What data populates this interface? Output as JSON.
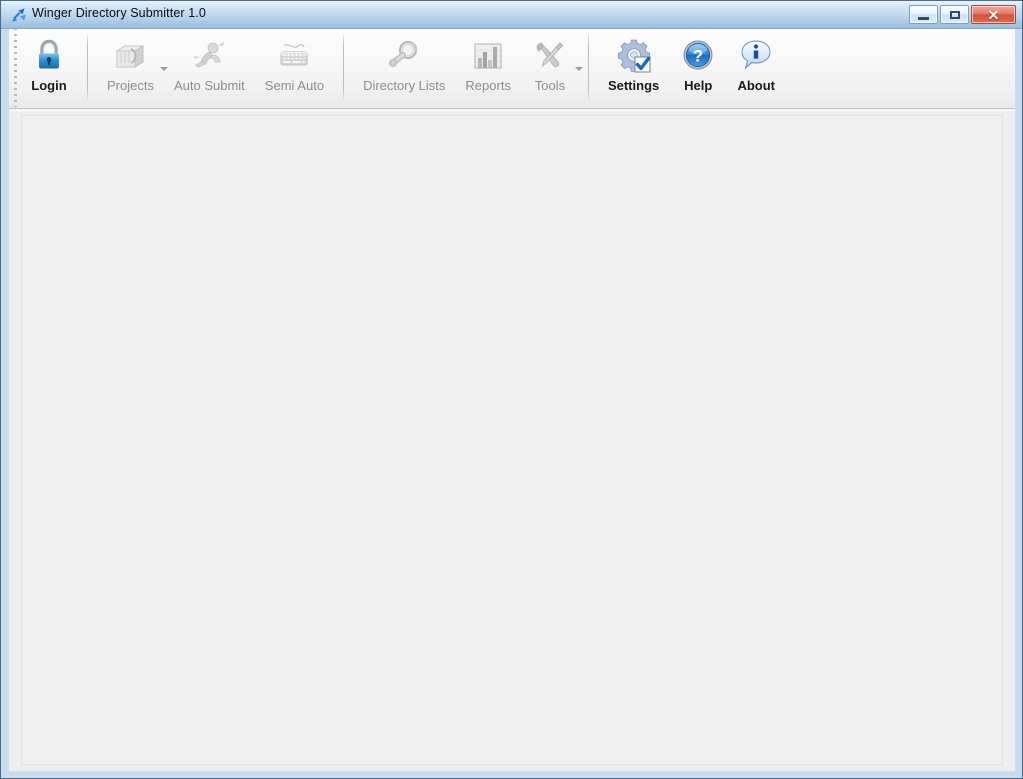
{
  "window": {
    "title": "Winger Directory Submitter 1.0",
    "app_icon": "blue-dart-icon",
    "controls": {
      "minimize_label": "Minimize",
      "maximize_label": "Maximize",
      "close_label": "Close"
    },
    "accent_color": "#a8c8e6",
    "frame_color": "#c9dcf0",
    "client_bg": "#eeeeee"
  },
  "toolbar": {
    "groups": [
      {
        "items": [
          {
            "label": "Login",
            "icon": "padlock-icon",
            "enabled": true,
            "has_dropdown": false
          }
        ]
      },
      {
        "items": [
          {
            "label": "Projects",
            "icon": "card-file-icon",
            "enabled": false,
            "has_dropdown": true
          },
          {
            "label": "Auto Submit",
            "icon": "running-person-icon",
            "enabled": false,
            "has_dropdown": false
          },
          {
            "label": "Semi Auto",
            "icon": "keyboard-icon",
            "enabled": false,
            "has_dropdown": false
          }
        ]
      },
      {
        "items": [
          {
            "label": "Directory Lists",
            "icon": "magnifier-icon",
            "enabled": false,
            "has_dropdown": false
          },
          {
            "label": "Reports",
            "icon": "bar-chart-icon",
            "enabled": false,
            "has_dropdown": false
          },
          {
            "label": "Tools",
            "icon": "wrench-screwdriver-icon",
            "enabled": false,
            "has_dropdown": true
          }
        ]
      },
      {
        "items": [
          {
            "label": "Settings",
            "icon": "gear-check-icon",
            "enabled": true,
            "has_dropdown": false
          },
          {
            "label": "Help",
            "icon": "question-circle-icon",
            "enabled": true,
            "has_dropdown": false
          },
          {
            "label": "About",
            "icon": "info-bubble-icon",
            "enabled": true,
            "has_dropdown": false
          }
        ]
      }
    ]
  },
  "content": {
    "empty": true,
    "text": ""
  }
}
